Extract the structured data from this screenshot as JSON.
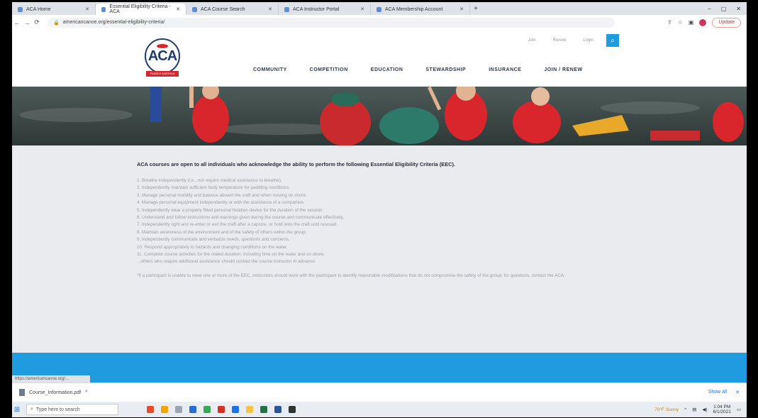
{
  "browser": {
    "tabs": [
      {
        "label": "ACA Home",
        "active": false
      },
      {
        "label": "Essential Eligibility Criteria - ACA",
        "active": true
      },
      {
        "label": "ACA Course Search",
        "active": false
      },
      {
        "label": "ACA Instructor Portal",
        "active": false
      },
      {
        "label": "ACA Membership Account",
        "active": false
      }
    ],
    "new_tab": "+",
    "window_controls": [
      "–",
      "▢",
      "✕"
    ],
    "back": "←",
    "forward": "→",
    "reload": "⟳",
    "url": "americancanoe.org/essential-eligibility-criteria/",
    "update_label": "Update"
  },
  "site": {
    "logo_text": "ACA",
    "logo_sub": "PADDLE AMERICA",
    "utility": [
      "Join",
      "Renew",
      "Login"
    ],
    "search_icon": "⌕",
    "nav": [
      "COMMUNITY",
      "COMPETITION",
      "EDUCATION",
      "STEWARDSHIP",
      "INSURANCE",
      "JOIN / RENEW"
    ]
  },
  "content": {
    "intro": "ACA courses are open to all individuals who acknowledge the ability to perform the following Essential Eligibility Criteria (EEC).",
    "criteria": [
      "1. Breathe independently (i.e., not require medical assistance to breathe).",
      "2. Independently maintain sufficient body temperature for paddling conditions.",
      "3. Manage personal mobility and balance aboard the craft and when moving on shore.",
      "4. Manage personal equipment independently or with the assistance of a companion.",
      "5. Independently wear a properly fitted personal flotation device for the duration of the session.",
      "6. Understand and follow instructions and warnings given during the course and communicate effectively.",
      "7. Independently right and re-enter or exit the craft after a capsize, or hold onto the craft until rescued.",
      "8. Maintain awareness of the environment and of the safety of others within the group.",
      "9. Independently communicate and verbalize needs, questions and concerns.",
      "10. Respond appropriately to hazards and changing conditions on the water.",
      "11. Complete course activities for the stated duration, including time on the water and on shore.",
      "     ...others who require additional assistance should contact the course instructor in advance."
    ],
    "footnote": "*If a participant is unable to meet one or more of the EEC, instructors should work with the participant to identify reasonable modifications that do not compromise the safety of the group; for questions, contact the ACA."
  },
  "status": {
    "link_preview": "https://americancanoe.org/..."
  },
  "downloads": {
    "item": "Course_Information.pdf",
    "menu": "^",
    "show_all": "Show all",
    "close": "✕"
  },
  "taskbar": {
    "start_icon": "⊞",
    "search_placeholder": "Type here to search",
    "weather": "70°F Sunny",
    "time": "1:04 PM",
    "date": "6/1/2021"
  },
  "colors": {
    "accent": "#1f9be0",
    "brand_navy": "#1f3b73",
    "brand_red": "#d8262e"
  }
}
